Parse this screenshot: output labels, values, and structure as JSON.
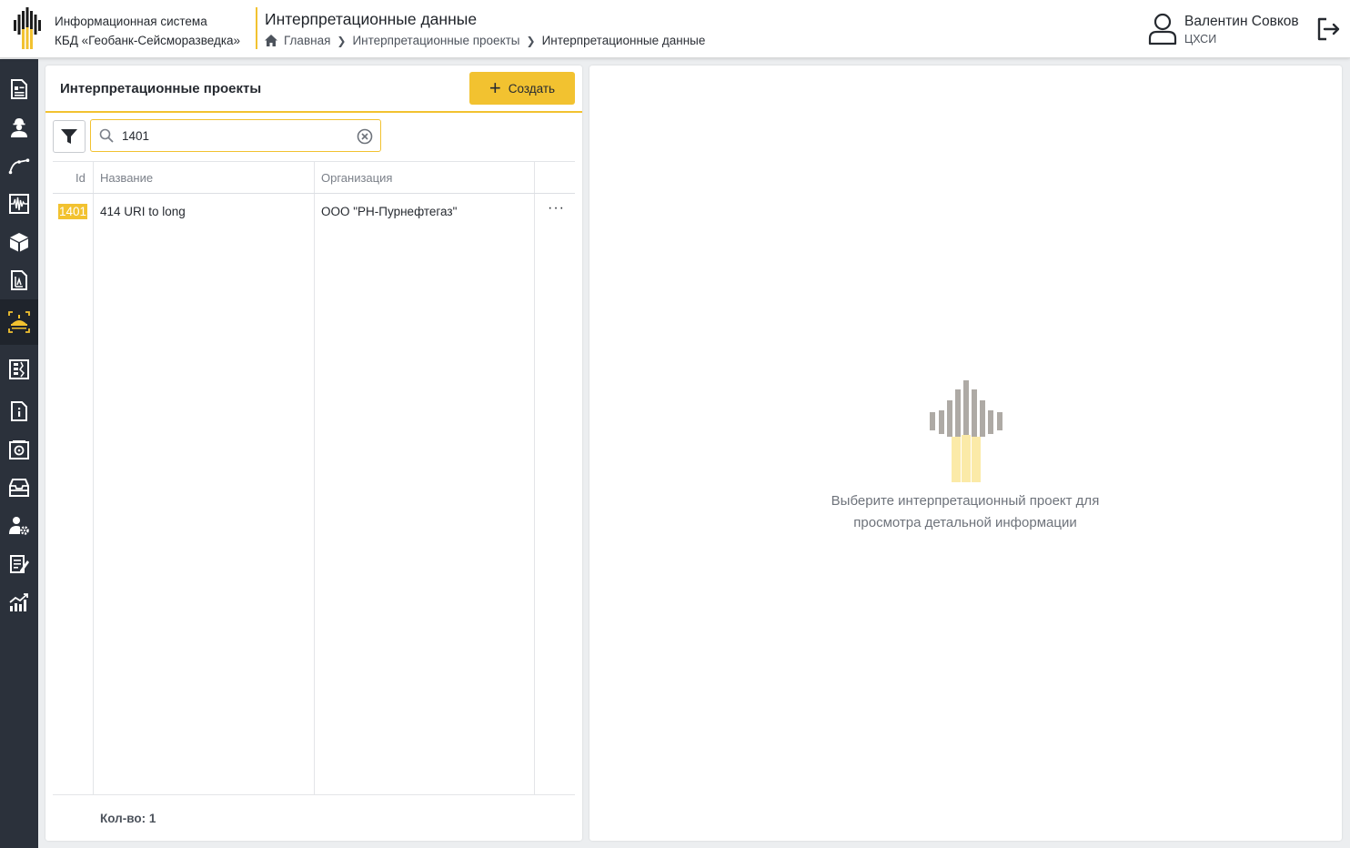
{
  "header": {
    "system_line1": "Информационная система",
    "system_line2": "КБД «Геобанк-Сейсморазведка»",
    "page_title": "Интерпретационные данные",
    "breadcrumb": [
      "Главная",
      "Интерпретационные проекты",
      "Интерпретационные данные"
    ],
    "user_name": "Валентин Совков",
    "user_org": "ЦХСИ"
  },
  "sidebar": {
    "items": [
      {
        "icon": "document-id-icon"
      },
      {
        "icon": "worker-icon"
      },
      {
        "icon": "profile-line-icon"
      },
      {
        "icon": "seismic-trace-icon"
      },
      {
        "icon": "cube-icon"
      },
      {
        "icon": "report-document-icon"
      },
      {
        "icon": "interpretation-icon",
        "active": true
      },
      {
        "icon": "well-log-icon"
      },
      {
        "icon": "file-info-icon"
      },
      {
        "icon": "media-disk-icon"
      },
      {
        "icon": "archive-tray-icon"
      },
      {
        "icon": "user-settings-icon"
      },
      {
        "icon": "notes-edit-icon"
      },
      {
        "icon": "statistics-chart-icon"
      }
    ]
  },
  "projects": {
    "title": "Интерпретационные проекты",
    "create_label": "Создать",
    "search_value": "1401",
    "columns": [
      "Id",
      "Название",
      "Организация"
    ],
    "rows": [
      {
        "id": "1401",
        "name": "414 URI to long",
        "org": "ООО \"РН-Пурнефтегаз\"",
        "menu": "···"
      }
    ],
    "count_label": "Кол-во: 1"
  },
  "details": {
    "empty_line1": "Выберите интерпретационный проект для",
    "empty_line2": "просмотра детальной информации"
  },
  "colors": {
    "accent": "#f2c230",
    "sidebar_bg": "#2b313b",
    "logo_gray": "#aeaaa5",
    "logo_light_yellow": "#fbeaa8"
  }
}
